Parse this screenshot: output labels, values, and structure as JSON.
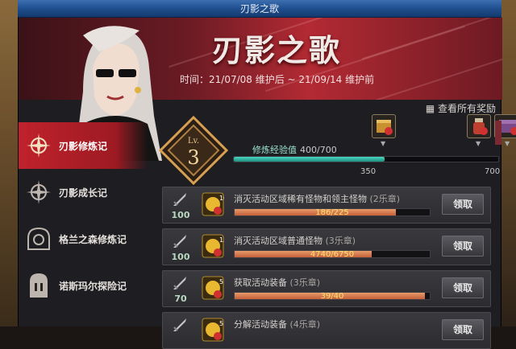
{
  "window": {
    "title": "刃影之歌"
  },
  "banner": {
    "title": "刃影之歌",
    "time": "时间：21/07/08 维护后 ~ 21/09/14 维护前"
  },
  "sidebar": {
    "items": [
      {
        "label": "刃影修炼记",
        "active": true
      },
      {
        "label": "刃影成长记",
        "active": false
      },
      {
        "label": "格兰之森修炼记",
        "active": false
      },
      {
        "label": "诺斯玛尔探险记",
        "active": false
      }
    ]
  },
  "header": {
    "view_all": "查看所有奖励"
  },
  "level": {
    "prefix": "Lv.",
    "value": "3"
  },
  "exp": {
    "label": "修炼经验值",
    "value": "400/700",
    "current": 400,
    "max": 700,
    "ticks": [
      "350",
      "700"
    ]
  },
  "quests": [
    {
      "title": "消灭活动区域稀有怪物和领主怪物",
      "chapter": "(2乐章)",
      "count": "100",
      "coin": "10",
      "progress_text": "186/225",
      "progress": 0.827,
      "button": "领取"
    },
    {
      "title": "消灭活动区域普通怪物",
      "chapter": "(3乐章)",
      "count": "100",
      "coin": "15",
      "progress_text": "4740/6750",
      "progress": 0.702,
      "button": "领取"
    },
    {
      "title": "获取活动装备",
      "chapter": "(3乐章)",
      "count": "70",
      "coin": "5",
      "progress_text": "39/40",
      "progress": 0.975,
      "button": "领取"
    },
    {
      "title": "分解活动装备",
      "chapter": "(4乐章)",
      "count": "",
      "coin": "5",
      "progress_text": "",
      "progress": 0,
      "button": "领取"
    }
  ],
  "colors": {
    "accent": "#c0222c",
    "exp": "#3ac9b4",
    "progress": "#d5744a"
  }
}
